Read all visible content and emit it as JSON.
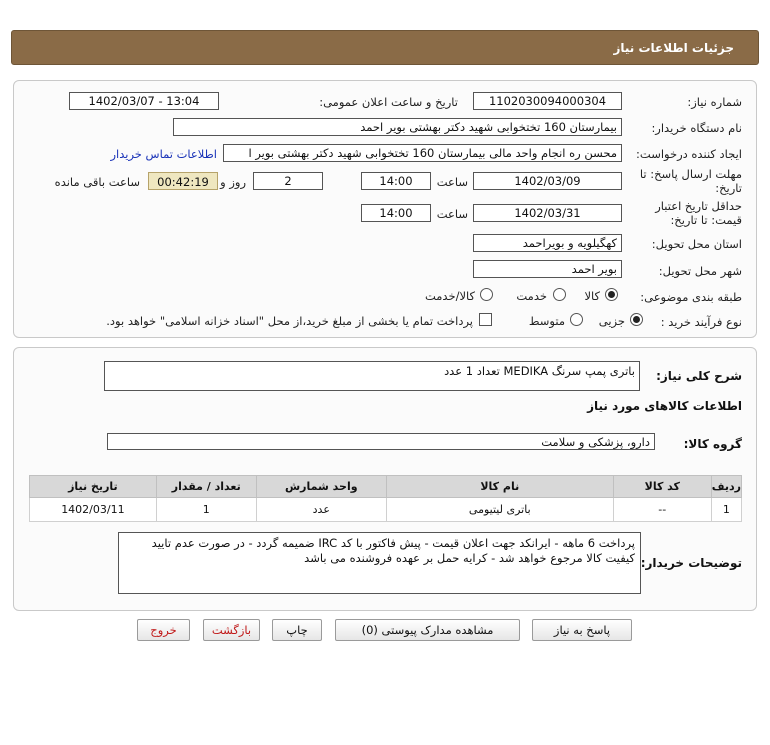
{
  "header": {
    "title": "جزئیات اطلاعات نیاز"
  },
  "form": {
    "need_number_label": "شماره نیاز:",
    "need_number": "1102030094000304",
    "announce_label": "تاریخ و ساعت اعلان عمومی:",
    "announce_value": "1402/03/07 - 13:04",
    "buyer_label": "نام دستگاه خریدار:",
    "buyer_value": "بیمارستان 160 تختخوابی شهید دکتر بهشتی بویر احمد",
    "creator_label": "ایجاد کننده درخواست:",
    "creator_value": "محسن ره انجام واحد مالی بیمارستان 160 تختخوابی شهید دکتر بهشتی بویر ا",
    "contact_link": "اطلاعات تماس خریدار",
    "deadline_label_1": "مهلت ارسال پاسخ: تا",
    "deadline_label_2": "تاریخ:",
    "deadline_date": "1402/03/09",
    "time_label": "ساعت",
    "deadline_time": "14:00",
    "days_value": "2",
    "days_label": "روز و",
    "remaining_time": "00:42:19",
    "remaining_label": "ساعت باقی مانده",
    "validity_label_1": "حداقل تاریخ اعتبار",
    "validity_label_2": "قیمت: تا تاریخ:",
    "validity_date": "1402/03/31",
    "validity_time": "14:00",
    "province_label": "استان محل تحویل:",
    "province_value": "کهگیلویه و بویراحمد",
    "city_label": "شهر محل تحویل:",
    "city_value": "بویر احمد",
    "category_label": "طبقه بندی موضوعی:",
    "category_options": [
      "کالا",
      "خدمت",
      "کالا/خدمت"
    ],
    "process_label": "نوع فرآیند خرید :",
    "process_options": [
      "جزیی",
      "متوسط"
    ],
    "payment_note": "پرداخت تمام یا بخشی از مبلغ خرید،از محل \"اسناد خزانه اسلامی\" خواهد بود."
  },
  "description": {
    "label": "شرح کلی نیاز:",
    "value": "باتری پمپ سرنگ MEDIKA تعداد 1 عدد"
  },
  "goods_section": {
    "title": "اطلاعات کالاهای مورد نیاز",
    "group_label": "گروه کالا:",
    "group_value": "دارو، پزشکی و سلامت",
    "columns": [
      "ردیف",
      "کد کالا",
      "نام کالا",
      "واحد شمارش",
      "تعداد / مقدار",
      "تاریخ نیاز"
    ],
    "rows": [
      {
        "row": "1",
        "code": "--",
        "name": "باتری لیتیومی",
        "unit": "عدد",
        "qty": "1",
        "date": "1402/03/11"
      }
    ]
  },
  "buyer_notes": {
    "label": "توضیحات خریدار:",
    "value": "پرداخت 6 ماهه - ایرانکد جهت اعلان قیمت - پیش فاکتور با کد IRC ضمیمه گردد - در صورت عدم تایید کیفیت کالا مرجوع خواهد شد - کرایه حمل بر عهده فروشنده می باشد"
  },
  "buttons": {
    "reply": "پاسخ به نیاز",
    "attachments": "مشاهده مدارک پیوستی (0)",
    "print": "چاپ",
    "back": "بازگشت",
    "exit": "خروج"
  },
  "colors": {
    "header_bg": "#8a6b47",
    "link": "#1a33b8",
    "danger": "#c01818"
  }
}
